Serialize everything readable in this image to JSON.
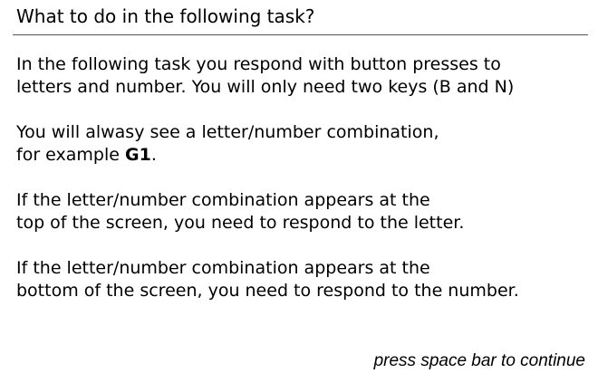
{
  "header": {
    "title": "What to do in the following task?"
  },
  "instructions": {
    "p1": {
      "line1": "In the following task you respond with button presses to",
      "line2": "letters and number. You will only need two keys (B and N)"
    },
    "p2": {
      "line1": "You will alwasy see a letter/number combination,",
      "line2_prefix": "for example ",
      "example_code": "G1",
      "line2_suffix": "."
    },
    "p3": {
      "line1": "If the letter/number combination appears at the",
      "line2": "top of the screen, you need to respond to the letter."
    },
    "p4": {
      "line1": "If the letter/number combination appears at the",
      "line2": "bottom of the screen, you need to respond to the number."
    }
  },
  "footer": {
    "continue_hint": "press space bar to continue"
  }
}
